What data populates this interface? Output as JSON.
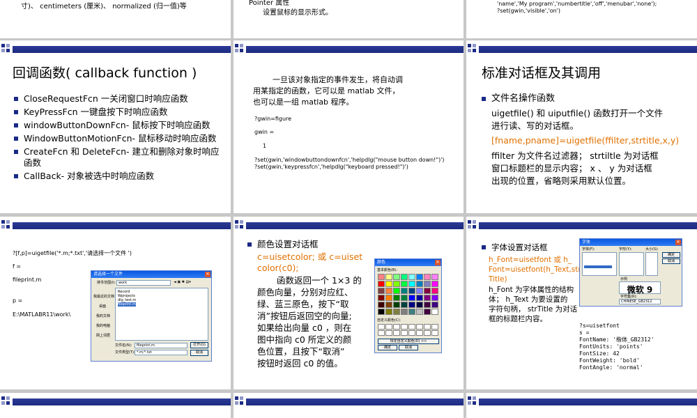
{
  "top_slides": {
    "left": [
      "寸)、 centimeters (厘米)、 normalized (归一值)等"
    ],
    "middle": [
      "Pointer 属性",
      "设置鼠标的显示形式。"
    ],
    "right": [
      "'name','My program','numbertitle','off','menubar','none');",
      "?set(gwin,'visible','on')"
    ]
  },
  "callback_slide": {
    "title": "回调函数( callback function )",
    "bullets": [
      "CloseRequestFcn 一关闭窗口时响应函数",
      "KeyPressFcn 一键盘按下时响应函数",
      "windowButtonDownFcn- 鼠标按下时响应函数",
      "WindowButtonMotionFcn- 鼠标移动时响应函数",
      "CreateFcn 和 DeleteFcn- 建立和删除对象时响应函数",
      "CallBack- 对象被选中时响应函数"
    ]
  },
  "event_slide": {
    "para": [
      "一旦该对象指定的事件发生，将自动调",
      "用某指定的函数，它可以是 matlab 文件，",
      "也可以是一组 matlab 程序。"
    ],
    "code": [
      "?gwin=figure",
      "gwin =",
      "1",
      "?set(gwin,'windowbuttondownfcn','helpdlg(\"mouse button down!\")')",
      "?set(gwin,'keypressfcn','helpdlg(\"keyboard pressed!\")')"
    ]
  },
  "dialog_slide": {
    "title": "标准对话框及其调用",
    "bullet": "文件名操作函数",
    "para1": [
      "uigetfile() 和 uiputfile() 函数打开一个文件",
      "进行读、写的对话框。"
    ],
    "formula": "[fname,pname]=uigetfile(ffilter,strtitle,x,y)",
    "para2": [
      "ffilter 为文件名过滤器； strtiltle 为对话框",
      "窗口标题栏的显示内容； x 、 y 为对话框",
      "出现的位置，省略则采用默认位置。"
    ]
  },
  "uigetfile_slide": {
    "code": [
      "?[f,p]=uigetfile('*.m;*.txt','请选择一个文件 ')",
      "f =",
      "fileprint.m",
      "p =",
      "E:\\MATLABR11\\work\\"
    ],
    "dialog_title": "请选择一个文件",
    "dialog_lookin_label": "搜寻范围(I):",
    "dialog_lookin_value": "work",
    "dialog_places": [
      "我最近的文档",
      "桌面",
      "我的文档",
      "我的电脑",
      "网上邻居"
    ],
    "dialog_files": [
      "Record",
      "Wprojects",
      "dlg_test.m",
      "fileprint.m"
    ],
    "dialog_filename_label": "文件名(N):",
    "dialog_filename_value": "fileprint.m",
    "dialog_type_label": "文件类型(T):",
    "dialog_type_value": "*.m;*.txt",
    "dialog_open": "打开(O)",
    "dialog_cancel": "取消"
  },
  "color_slide": {
    "bullet": "颜色设置对话框",
    "formula": [
      "c=uisetcolor;  或   c=uiset",
      "color(c0);"
    ],
    "para": [
      "函数返回一个 1×3 的",
      "颜色向量，分别对应红、",
      "绿、蓝三原色，按下“取",
      "消”按钮后返回空的向量;",
      "如果给出向量 c0 ，则在",
      "图中指向 c0 所定义的颜",
      "色位置，且按下“取消”",
      "按钮时返回 c0 的值。"
    ],
    "dialog_title": "颜色",
    "dialog_basic": "基本颜色(B):",
    "dialog_custom": "自定义颜色(C):",
    "dialog_define": "规定自定义颜色(D) >>",
    "dialog_ok": "确定",
    "dialog_cancel": "取消",
    "swatches": [
      "#ff8080",
      "#ffff80",
      "#80ff80",
      "#00ff80",
      "#80ffff",
      "#0080ff",
      "#ff80c0",
      "#ff80ff",
      "#ff0000",
      "#ffff00",
      "#80ff00",
      "#00ff40",
      "#00ffff",
      "#0080c0",
      "#8080c0",
      "#ff00ff",
      "#804040",
      "#ff8040",
      "#00ff00",
      "#008080",
      "#004080",
      "#8080ff",
      "#800040",
      "#ff0080",
      "#800000",
      "#ff8000",
      "#008000",
      "#008040",
      "#0000ff",
      "#0000a0",
      "#800080",
      "#8000ff",
      "#400000",
      "#804000",
      "#004000",
      "#004040",
      "#000080",
      "#000040",
      "#400040",
      "#400080",
      "#000000",
      "#808000",
      "#808040",
      "#808080",
      "#408080",
      "#c0c0c0",
      "#400040",
      "#ffffff"
    ]
  },
  "font_slide": {
    "bullet": "字体设置对话框",
    "formula": [
      "h_Font=uisetfont  或    h_",
      "Font=uisetfont(h_Text,str",
      "Title)"
    ],
    "para": [
      "h_Font 为字体属性的结构",
      "体； h_Text 为要设置的",
      "字符句柄， strTitle 为对话",
      "框的标题栏内容。"
    ],
    "code": [
      "?s=uisetfont",
      "s =",
      "      FontName: '楷体_GB2312'",
      "     FontUnits: 'points'",
      "      FontSize: 42",
      "    FontWeight: 'bold'",
      "     FontAngle: 'normal'"
    ],
    "dialog_title": "字体",
    "dialog_font_label": "字体(F):",
    "dialog_style_label": "字形(Y):",
    "dialog_size_label": "大小(S):",
    "dialog_ok": "确定",
    "dialog_cancel": "取消",
    "dialog_sample_label": "示例",
    "dialog_sample": "微软 9",
    "dialog_script_label": "字符集(R):",
    "dialog_script_value": "CHINESE_GB2312"
  }
}
